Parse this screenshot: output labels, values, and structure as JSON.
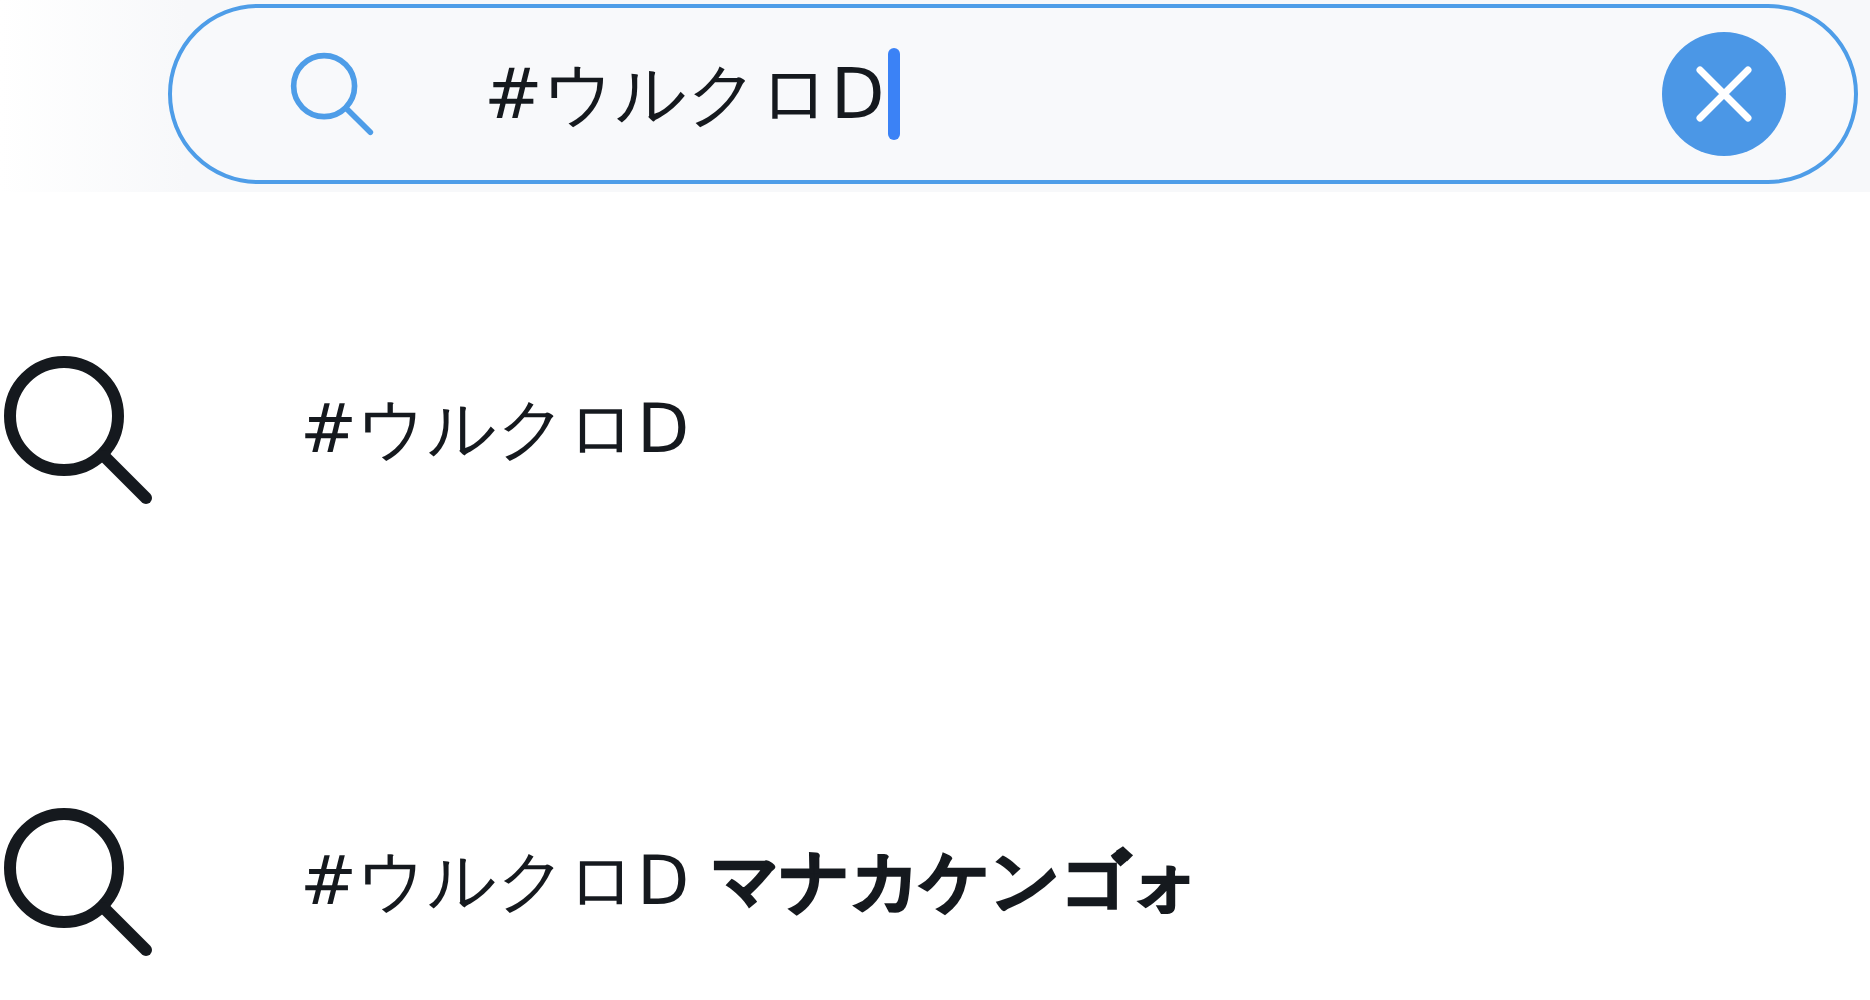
{
  "search": {
    "value": "#ウルクロD",
    "focused": true
  },
  "suggestions": [
    {
      "text": "#ウルクロD"
    },
    {
      "text": "#ウルクロD **マナカケンゴォ**"
    }
  ]
}
